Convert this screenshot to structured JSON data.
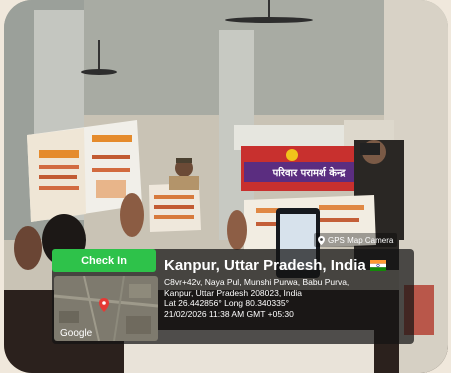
{
  "gps_badge": {
    "label": "GPS Map Camera"
  },
  "sign": {
    "text": "परिवार परामर्श केन्द्र"
  },
  "overlay": {
    "checkin_label": "Check In",
    "location_title": "Kanpur, Uttar Pradesh, India",
    "address_lines": [
      "C8vr+42v, Naya Pul, Munshi Purwa, Babu Purva,",
      "Kanpur, Uttar Pradesh 208023, India",
      "Lat 26.442856° Long 80.340335°",
      "21/02/2026 11:38 AM GMT +05:30"
    ],
    "map_brand": "Google",
    "flag_icon": "india-flag-icon"
  },
  "colors": {
    "checkin_green": "#2ec24a",
    "map_pin": "#e53935"
  }
}
